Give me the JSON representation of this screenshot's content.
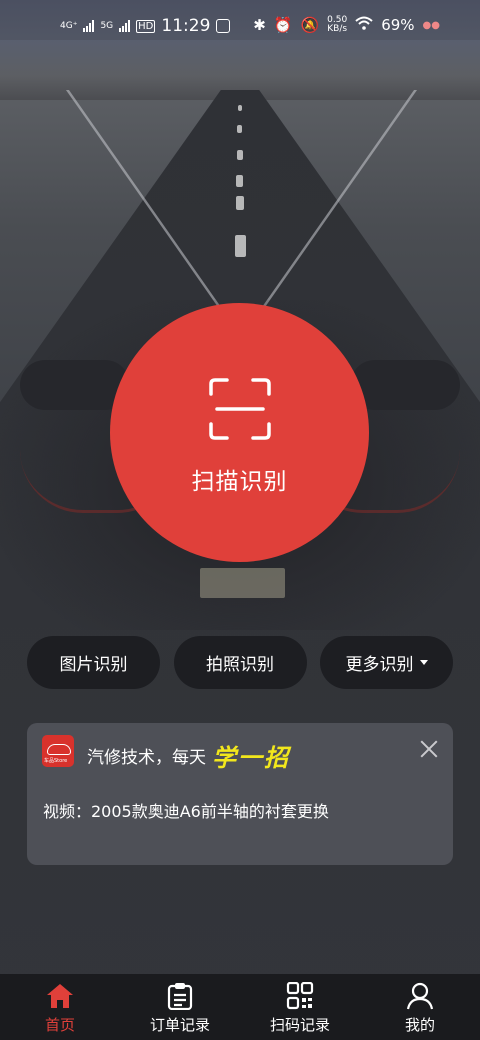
{
  "status_bar": {
    "network_1": "4G⁺",
    "network_2": "5G",
    "hd": "HD",
    "time": "11:29",
    "speed_value": "0.50",
    "speed_unit": "KB/s",
    "battery": "69%"
  },
  "scan": {
    "label": "扫描识别",
    "icon": "scan-frame-icon"
  },
  "buttons": {
    "image_recognition": "图片识别",
    "photo_recognition": "拍照识别",
    "more_recognition": "更多识别"
  },
  "tip_card": {
    "title": "汽修技术，每天",
    "highlight": "学一招",
    "video": "视频：2005款奥迪A6前半轴的衬套更换",
    "logo_text": "车品Store"
  },
  "nav": [
    {
      "label": "首页",
      "icon": "home-icon",
      "active": true
    },
    {
      "label": "订单记录",
      "icon": "clipboard-list-icon",
      "active": false
    },
    {
      "label": "扫码记录",
      "icon": "qr-code-icon",
      "active": false
    },
    {
      "label": "我的",
      "icon": "user-icon",
      "active": false
    }
  ],
  "colors": {
    "accent": "#e0403a",
    "highlight": "#f2e71c",
    "pill_bg": "#1d1e22",
    "nav_bg": "#1a1b1e"
  }
}
